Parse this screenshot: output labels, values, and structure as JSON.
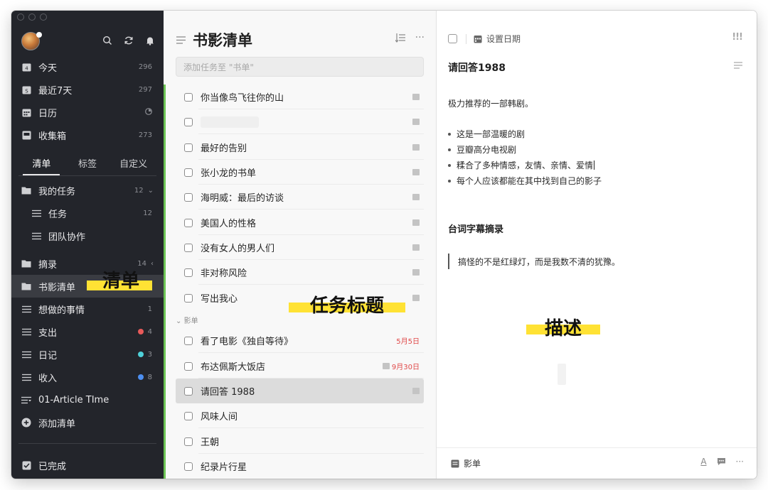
{
  "sidebar": {
    "smart_lists": [
      {
        "label": "今天",
        "count": "296",
        "icon": "calendar-today-icon"
      },
      {
        "label": "最近7天",
        "count": "297",
        "icon": "calendar-week-icon"
      },
      {
        "label": "日历",
        "count": "",
        "icon": "calendar-icon"
      },
      {
        "label": "收集箱",
        "count": "273",
        "icon": "inbox-icon"
      }
    ],
    "tabs": [
      "清单",
      "标签",
      "自定义"
    ],
    "folders": [
      {
        "label": "我的任务",
        "count": "12"
      },
      {
        "label": "任务",
        "count": "12"
      },
      {
        "label": "团队协作",
        "count": ""
      },
      {
        "label": "摘录",
        "count": "14"
      },
      {
        "label": "书影清单",
        "count": ""
      },
      {
        "label": "想做的事情",
        "count": "1"
      },
      {
        "label": "支出",
        "count": "4"
      },
      {
        "label": "日记",
        "count": "3"
      },
      {
        "label": "收入",
        "count": "8"
      },
      {
        "label": "01-Article TIme",
        "count": ""
      },
      {
        "label": "添加清单",
        "count": ""
      }
    ],
    "completed": "已完成",
    "dot_colors": {
      "expense": "#e85a5a",
      "diary": "#4fd1d9",
      "income": "#4d8ff0"
    }
  },
  "annotations": {
    "list": "清单",
    "task_title": "任务标题",
    "description": "描述"
  },
  "list": {
    "title": "书影清单",
    "add_placeholder": "添加任务至 \"书单\"",
    "section": "影单",
    "tasks": [
      {
        "title": "你当像鸟飞往你的山",
        "due": ""
      },
      {
        "title": "",
        "due": ""
      },
      {
        "title": "最好的告别",
        "due": ""
      },
      {
        "title": "张小龙的书单",
        "due": ""
      },
      {
        "title": "海明威：最后的访谈",
        "due": ""
      },
      {
        "title": "美国人的性格",
        "due": ""
      },
      {
        "title": "没有女人的男人们",
        "due": ""
      },
      {
        "title": "非对称风险",
        "due": ""
      },
      {
        "title": "写出我心",
        "due": ""
      }
    ],
    "movies": [
      {
        "title": "看了电影《独自等待》",
        "due": "5月5日"
      },
      {
        "title": "布达佩斯大饭店",
        "due": "9月30日"
      },
      {
        "title": "请回答 1988",
        "due": ""
      },
      {
        "title": "风味人间",
        "due": ""
      },
      {
        "title": "王朝",
        "due": ""
      },
      {
        "title": "纪录片行星",
        "due": ""
      }
    ]
  },
  "detail": {
    "set_date": "设置日期",
    "priority": "!!!",
    "title": "请回答1988",
    "intro": "极力推荐的一部韩剧。",
    "bullets": [
      "这是一部温暖的剧",
      "豆瓣高分电视剧",
      "糅合了多种情感，友情、亲情、爱情",
      "每个人应该都能在其中找到自己的影子"
    ],
    "heading": "台词字幕摘录",
    "quote": "搞怪的不是红绿灯，而是我数不清的犹豫。",
    "footer_list": "影单"
  }
}
